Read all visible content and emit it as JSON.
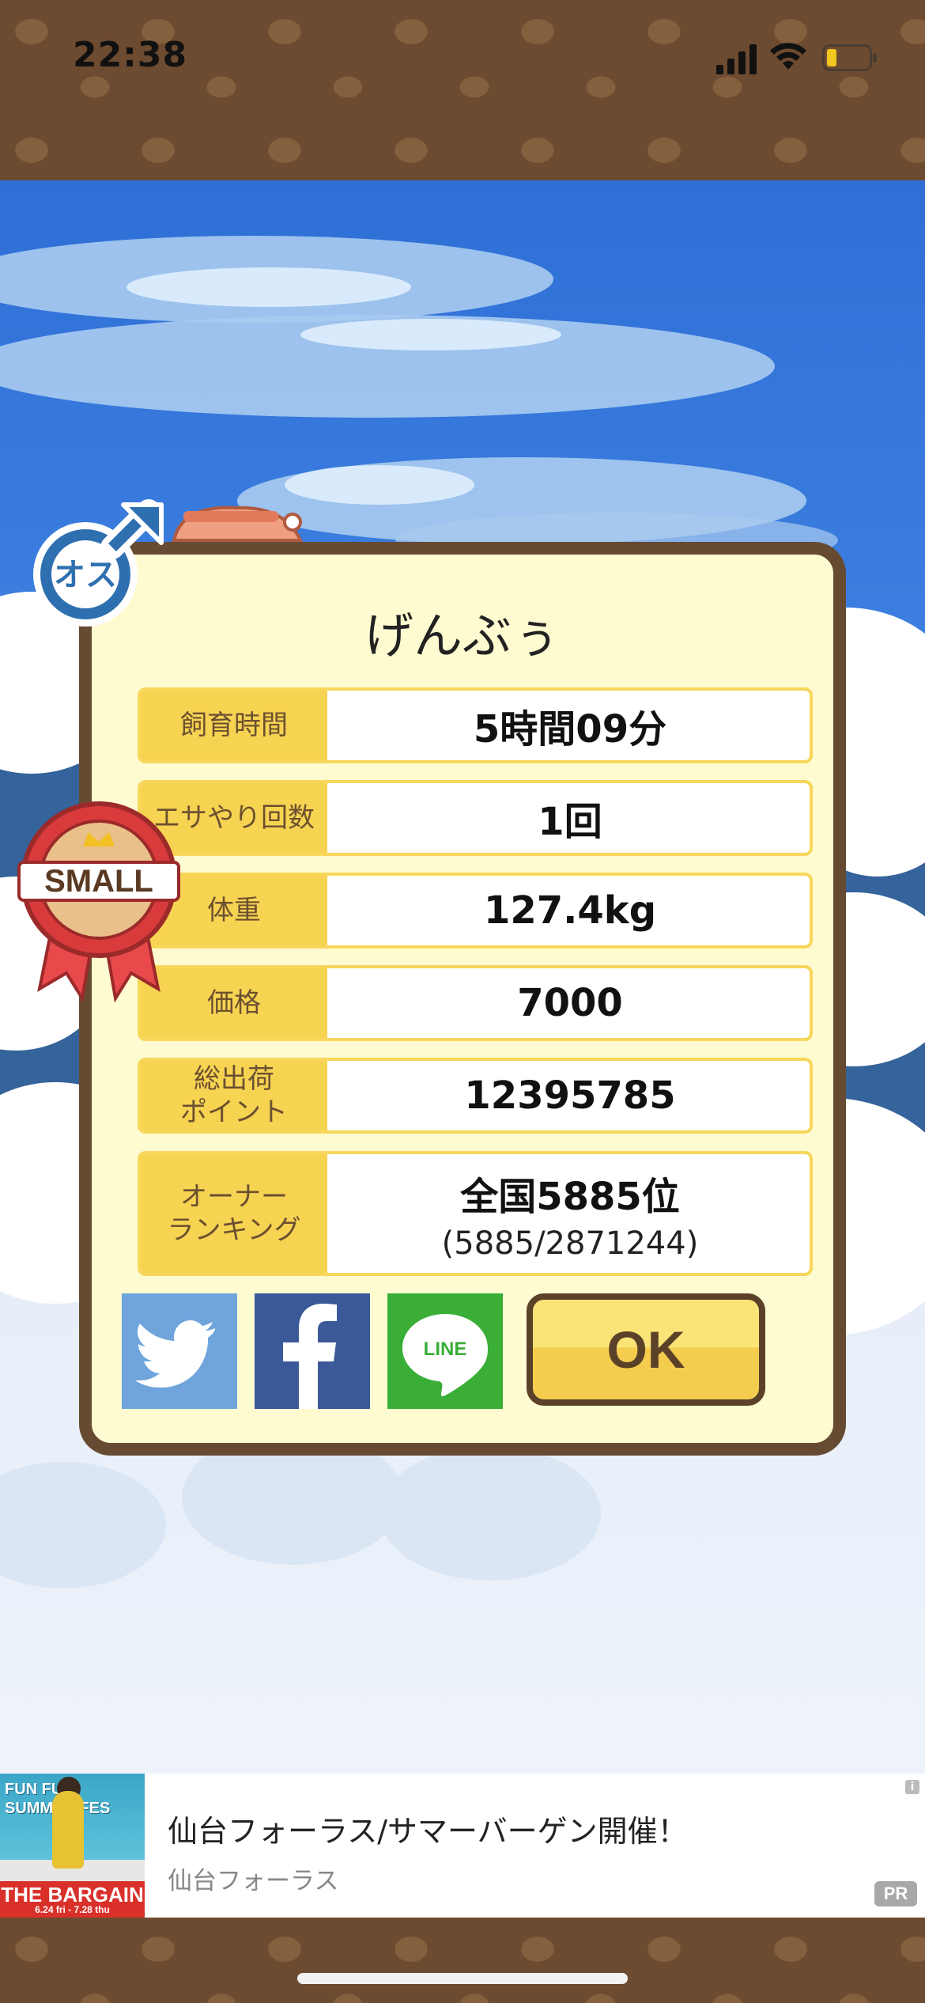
{
  "status_bar": {
    "time": "22:38"
  },
  "dialog": {
    "pig_name": "げんぶぅ",
    "rows": [
      {
        "label": "飼育時間",
        "value": "5時間09分"
      },
      {
        "label": "エサやり回数",
        "value": "1回"
      },
      {
        "label": "体重",
        "value": "127.4kg"
      },
      {
        "label": "価格",
        "value": "7000"
      },
      {
        "label": "総出荷\nポイント",
        "value": "12395785"
      }
    ],
    "ranking": {
      "label": "オーナー\nランキング",
      "value": "全国5885位",
      "detail": "(5885/2871244)"
    },
    "buttons": {
      "twitter": "twitter",
      "facebook": "facebook",
      "line": "LINE",
      "ok": "OK"
    }
  },
  "badges": {
    "gender": "オス",
    "size": "SMALL"
  },
  "ad": {
    "title": "仙台フォーラス/サマーバーゲン開催！",
    "sponsor": "仙台フォーラス",
    "image_heading": "FUN FUN SUMMER FES",
    "image_banner": "THE BARGAIN",
    "image_dates": "6.24 fri - 7.28 thu",
    "info_icon": "i",
    "pr_label": "PR"
  },
  "colors": {
    "frame_brown": "#664b32",
    "label_yellow": "#f7d352",
    "dialog_bg": "#fffbd1"
  }
}
